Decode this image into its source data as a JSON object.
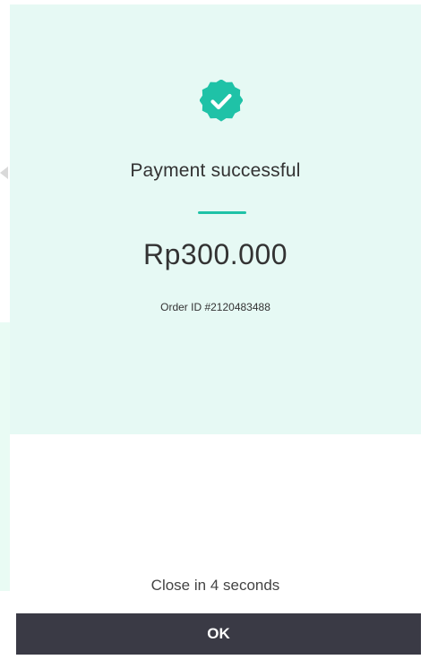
{
  "payment": {
    "status_title": "Payment successful",
    "amount": "Rp300.000",
    "order_id": "Order ID #2120483488"
  },
  "footer": {
    "countdown": "Close in 4 seconds",
    "ok_label": "OK"
  },
  "icons": {
    "status": "check-badge-icon"
  },
  "colors": {
    "success_bg": "#e6f9f4",
    "accent": "#1fc2a7",
    "button_bg": "#3a3a45",
    "text": "#333333"
  }
}
